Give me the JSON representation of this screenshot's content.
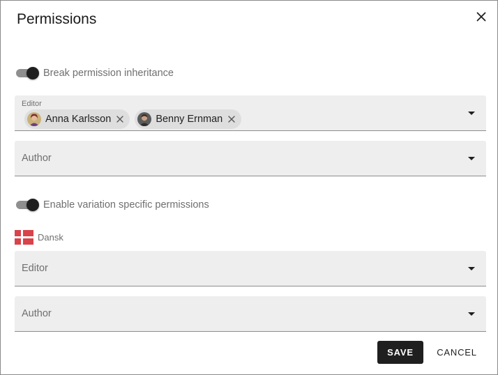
{
  "dialog": {
    "title": "Permissions",
    "close_icon": "close-icon"
  },
  "inheritance": {
    "toggle_label": "Break permission inheritance",
    "toggle_on": true,
    "editor_label": "Editor",
    "editor_chips": [
      {
        "name": "Anna Karlsson",
        "avatar_icon": "user-avatar-icon",
        "remove_icon": "close-icon"
      },
      {
        "name": "Benny Ernman",
        "avatar_icon": "user-avatar-icon",
        "remove_icon": "close-icon"
      }
    ],
    "author_placeholder": "Author"
  },
  "variation": {
    "toggle_label": "Enable variation specific permissions",
    "toggle_on": true,
    "language": {
      "flag_icon": "denmark-flag-icon",
      "label": "Dansk"
    },
    "editor_placeholder": "Editor",
    "author_placeholder": "Author"
  },
  "actions": {
    "save_label": "SAVE",
    "cancel_label": "CANCEL"
  },
  "colors": {
    "primary_button": "#1f1f1f",
    "field_background": "#eeeeee",
    "chip_background": "#dedede",
    "flag_red": "#d9434a"
  }
}
